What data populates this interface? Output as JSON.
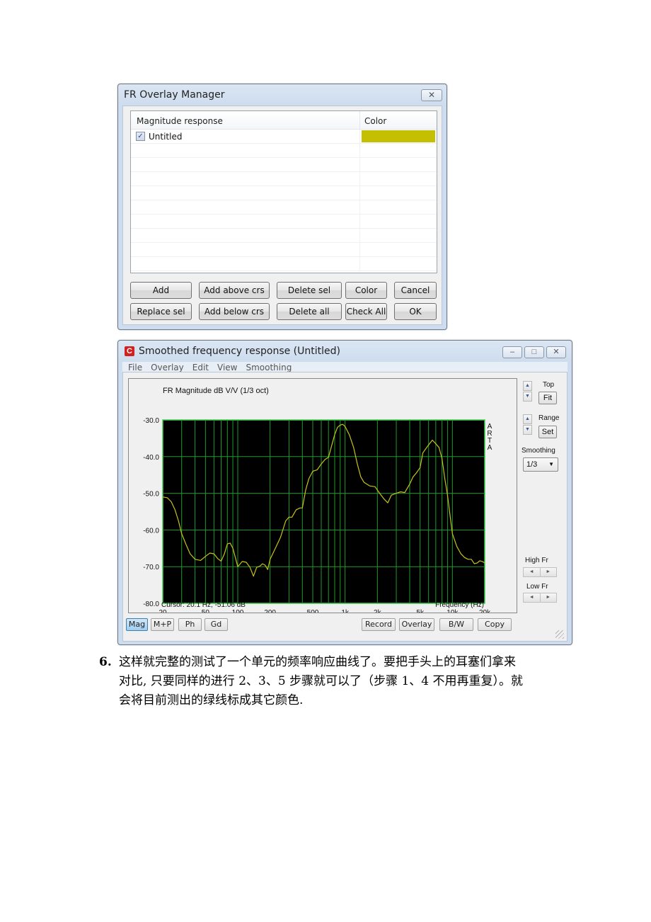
{
  "overlay_manager": {
    "title": "FR Overlay Manager",
    "close_icon": "close-x-icon",
    "columns": [
      "Magnitude response",
      "Color"
    ],
    "rows": [
      {
        "name": "Untitled",
        "checked": true,
        "color": "#c4bf00"
      },
      {
        "name": "",
        "checked": false,
        "color": ""
      },
      {
        "name": "",
        "checked": false,
        "color": ""
      },
      {
        "name": "",
        "checked": false,
        "color": ""
      },
      {
        "name": "",
        "checked": false,
        "color": ""
      },
      {
        "name": "",
        "checked": false,
        "color": ""
      },
      {
        "name": "",
        "checked": false,
        "color": ""
      },
      {
        "name": "",
        "checked": false,
        "color": ""
      },
      {
        "name": "",
        "checked": false,
        "color": ""
      },
      {
        "name": "",
        "checked": false,
        "color": ""
      }
    ],
    "buttons": {
      "add": "Add",
      "add_above": "Add above crs",
      "delete_sel": "Delete sel",
      "color": "Color",
      "cancel": "Cancel",
      "replace_sel": "Replace sel",
      "add_below": "Add below crs",
      "delete_all": "Delete all",
      "check_all": "Check All",
      "ok": "OK"
    }
  },
  "fr_window": {
    "title": "Smoothed frequency response (Untitled)",
    "app_icon": "arta-app-icon",
    "caption": {
      "minimize": "–",
      "maximize": "□",
      "close": "✕"
    },
    "menu": [
      "File",
      "Overlay",
      "Edit",
      "View",
      "Smoothing"
    ],
    "side_panel": {
      "top_label": "Top",
      "fit_button": "Fit",
      "range_label": "Range",
      "set_button": "Set",
      "smoothing_label": "Smoothing",
      "smoothing_value": "1/3",
      "high_fr_label": "High Fr",
      "low_fr_label": "Low Fr",
      "spin_up": "▲",
      "spin_down": "▼",
      "arrow_left": "◄",
      "arrow_right": "►"
    },
    "bottom_buttons": {
      "mag": "Mag",
      "mp": "M+P",
      "ph": "Ph",
      "gd": "Gd",
      "record": "Record",
      "overlay": "Overlay",
      "bw": "B/W",
      "copy": "Copy"
    },
    "active_mode": "Mag"
  },
  "chart_data": {
    "type": "line",
    "title": "FR Magnitude dB V/V (1/3 oct)",
    "xlabel": "Frequency (Hz)",
    "ylabel": "",
    "xscale": "log",
    "xlim": [
      20,
      20000
    ],
    "ylim": [
      -80,
      -30
    ],
    "x_ticks": [
      20,
      50,
      100,
      200,
      500,
      1000,
      2000,
      5000,
      10000,
      20000
    ],
    "x_tick_labels": [
      "20",
      "50",
      "100",
      "200",
      "500",
      "1k",
      "2k",
      "5k",
      "10k",
      "20k"
    ],
    "y_ticks": [
      -30,
      -40,
      -50,
      -60,
      -70,
      -80
    ],
    "y_tick_labels": [
      "-30.0",
      "-40.0",
      "-50.0",
      "-60.0",
      "-70.0",
      "-80.0"
    ],
    "grid": true,
    "side_label": "ARTA",
    "cursor_readout": "Cursor: 20.1 Hz, -51.06 dB",
    "colors": {
      "background": "#000000",
      "grid": "#1f9a2a",
      "curve": "#c8c21a",
      "frame": "#3ccf4a"
    },
    "series": [
      {
        "name": "Untitled",
        "x": [
          20,
          22,
          24,
          26,
          28,
          30,
          33,
          36,
          40,
          45,
          50,
          55,
          60,
          65,
          70,
          75,
          80,
          85,
          90,
          95,
          100,
          105,
          110,
          120,
          130,
          140,
          150,
          160,
          170,
          180,
          190,
          200,
          220,
          250,
          280,
          300,
          320,
          350,
          380,
          400,
          430,
          460,
          500,
          550,
          600,
          650,
          700,
          750,
          800,
          850,
          900,
          950,
          1000,
          1050,
          1100,
          1200,
          1300,
          1400,
          1500,
          1700,
          1900,
          2100,
          2300,
          2500,
          2700,
          3000,
          3300,
          3600,
          4000,
          4300,
          4600,
          5000,
          5300,
          5600,
          6000,
          6500,
          7000,
          7500,
          8000,
          8500,
          9000,
          10000,
          11000,
          12000,
          13000,
          14000,
          15000,
          16000,
          17000,
          18000,
          19000,
          20000
        ],
        "y": [
          -51.0,
          -51.2,
          -52.3,
          -54.5,
          -57.5,
          -61.0,
          -64.0,
          -66.5,
          -68.0,
          -68.3,
          -67.2,
          -66.3,
          -66.5,
          -67.8,
          -68.5,
          -66.5,
          -63.8,
          -63.6,
          -65.0,
          -67.5,
          -70.0,
          -69.3,
          -68.6,
          -68.8,
          -70.2,
          -72.6,
          -70.2,
          -69.9,
          -69.2,
          -69.6,
          -70.8,
          -68.0,
          -65.5,
          -62.0,
          -57.5,
          -56.5,
          -56.5,
          -54.5,
          -54.0,
          -54.0,
          -49.0,
          -46.0,
          -44.0,
          -43.6,
          -42.0,
          -40.8,
          -40.2,
          -37.0,
          -34.0,
          -32.0,
          -31.4,
          -31.2,
          -31.8,
          -33.0,
          -34.2,
          -37.5,
          -42.0,
          -45.5,
          -47.0,
          -48.0,
          -48.2,
          -50.0,
          -51.5,
          -52.6,
          -50.5,
          -50.0,
          -49.6,
          -49.8,
          -47.5,
          -45.5,
          -44.5,
          -43.0,
          -39.0,
          -38.0,
          -36.8,
          -35.5,
          -36.5,
          -37.5,
          -40.5,
          -46.0,
          -50.5,
          -61.0,
          -64.5,
          -66.5,
          -67.5,
          -68.0,
          -68.0,
          -69.2,
          -69.0,
          -68.4,
          -68.6,
          -69.0,
          -70.5
        ]
      }
    ]
  },
  "document": {
    "item_number": "6.",
    "lines": [
      "这样就完整的测试了一个单元的频率响应曲线了。要把手头上的耳塞们拿来",
      "对比, 只要同样的进行 2、3、5 步骤就可以了（步骤 1、4 不用再重复）。就",
      "会将目前测出的绿线标成其它颜色."
    ]
  }
}
